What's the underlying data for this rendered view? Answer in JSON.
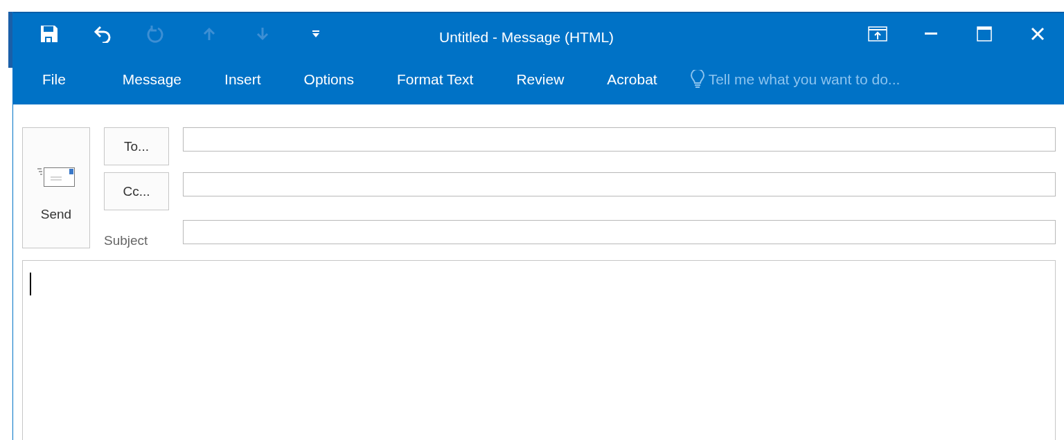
{
  "window": {
    "title": "Untitled - Message (HTML)"
  },
  "quick_access": [
    {
      "kind": "save",
      "disabled": false
    },
    {
      "kind": "undo",
      "disabled": false
    },
    {
      "kind": "redo",
      "disabled": true
    },
    {
      "kind": "up",
      "disabled": true
    },
    {
      "kind": "down",
      "disabled": true
    },
    {
      "kind": "customize",
      "disabled": false
    }
  ],
  "tabs": [
    {
      "label": "File",
      "selected": false
    },
    {
      "label": "Message",
      "selected": false
    },
    {
      "label": "Insert",
      "selected": false
    },
    {
      "label": "Options",
      "selected": false
    },
    {
      "label": "Format Text",
      "selected": false
    },
    {
      "label": "Review",
      "selected": false
    },
    {
      "label": "Acrobat",
      "selected": false
    }
  ],
  "tell_me": {
    "placeholder": "Tell me what you want to do..."
  },
  "send_button": {
    "label": "Send"
  },
  "to_button": {
    "label": "To..."
  },
  "cc_button": {
    "label": "Cc..."
  },
  "subject_label": "Subject"
}
